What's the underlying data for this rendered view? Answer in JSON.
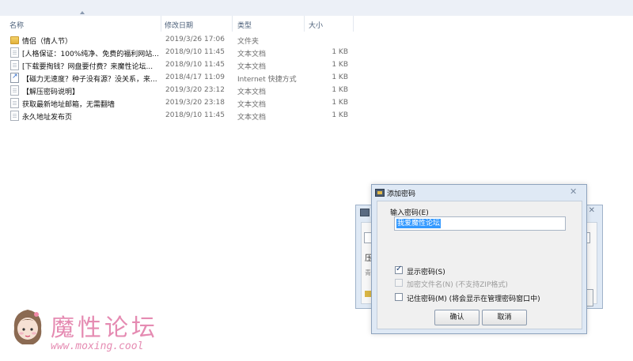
{
  "columns": {
    "name": "名称",
    "date": "修改日期",
    "type": "类型",
    "size": "大小"
  },
  "files": [
    {
      "icon": "folder-icon",
      "name": "情侣（情人节）",
      "date": "2019/3/26 17:06",
      "type": "文件夹",
      "size": ""
    },
    {
      "icon": "text-file-icon",
      "name": "[人格保证：100%纯净、免费的福利网站...",
      "date": "2018/9/10 11:45",
      "type": "文本文档",
      "size": "1 KB"
    },
    {
      "icon": "text-file-icon",
      "name": "[下载要掏钱？网盘要付费？来魔性论坛...",
      "date": "2018/9/10 11:45",
      "type": "文本文档",
      "size": "1 KB"
    },
    {
      "icon": "shortcut-icon",
      "name": "【磁力无速度？种子没有源？没关系，来...",
      "date": "2018/4/17 11:09",
      "type": "Internet 快捷方式",
      "size": "1 KB"
    },
    {
      "icon": "text-file-icon",
      "name": "【解压密码说明】",
      "date": "2019/3/20 23:12",
      "type": "文本文档",
      "size": "1 KB"
    },
    {
      "icon": "text-file-icon",
      "name": "获取最新地址邮箱，无需翻墙",
      "date": "2019/3/20 23:18",
      "type": "文本文档",
      "size": "1 KB"
    },
    {
      "icon": "text-file-icon",
      "name": "永久地址发布页",
      "date": "2018/9/10 11:45",
      "type": "文本文档",
      "size": "1 KB"
    }
  ],
  "background_dialog": {
    "title_glyph": "添",
    "left_glyphs": [
      "压",
      "青"
    ]
  },
  "dialog": {
    "title": "添加密码",
    "password_label": "输入密码(E)",
    "password_value": "我爱魔性论坛",
    "show_password": {
      "label": "显示密码(S)",
      "checked": true,
      "enabled": true
    },
    "encrypt_filenames": {
      "label": "加密文件名(N) (不支持ZIP格式)",
      "checked": false,
      "enabled": false
    },
    "remember_password": {
      "label": "记住密码(M) (将会显示在管理密码窗口中)",
      "checked": false,
      "enabled": true
    },
    "ok_label": "确认",
    "cancel_label": "取消",
    "accent_color": "#3399ff"
  },
  "watermark": {
    "brand": "魔性论坛",
    "url": "www.moxing.cool",
    "color": "#e58bb2"
  }
}
